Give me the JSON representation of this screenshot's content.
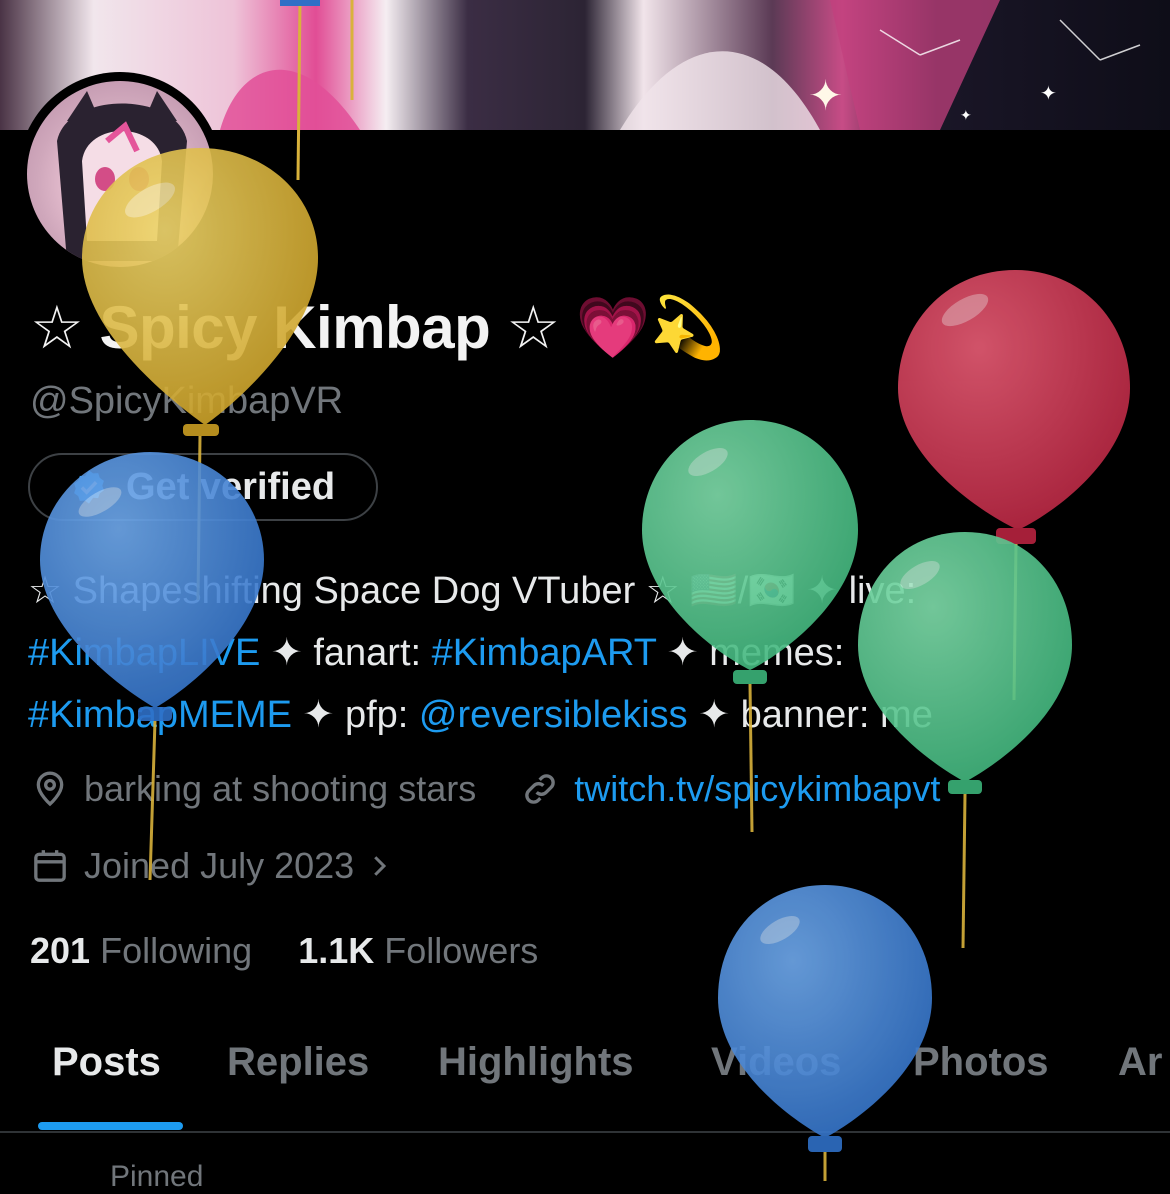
{
  "profile": {
    "display_name": "☆ Spicy Kimbap ☆ 💗💫",
    "handle": "@SpicyKimbapVR",
    "verify_button": "Get verified",
    "bio": {
      "line1_a": "☆ Shapeshifting Space Dog VTuber ☆ 🇺🇸/🇰🇷 ✦ live:",
      "line2_tag1": "#KimbapLIVE",
      "line2_mid": " ✦ fanart: ",
      "line2_tag2": "#KimbapART",
      "line2_end": " ✦ memes:",
      "line3_tag": "#KimbapMEME",
      "line3_mid": " ✦ pfp: ",
      "line3_mention": "@reversiblekiss",
      "line3_end": " ✦ banner: me"
    },
    "location": "barking at shooting stars",
    "website": "twitch.tv/spicykimbapvt",
    "joined": "Joined July 2023",
    "following_count": "201",
    "following_label": "Following",
    "followers_count": "1.1K",
    "followers_label": "Followers"
  },
  "tabs": [
    "Posts",
    "Replies",
    "Highlights",
    "Videos",
    "Photos",
    "Ar"
  ],
  "active_tab": "Posts",
  "pinned_label": "Pinned",
  "colors": {
    "accent": "#1d9bf0",
    "muted": "#71767b",
    "balloon_yellow": "#d8b43a",
    "balloon_blue": "#3f86d8",
    "balloon_green": "#52c78d",
    "balloon_red": "#c8334e"
  },
  "icons": [
    "location-pin-icon",
    "link-icon",
    "calendar-icon",
    "chevron-right-icon",
    "verified-badge-icon"
  ]
}
